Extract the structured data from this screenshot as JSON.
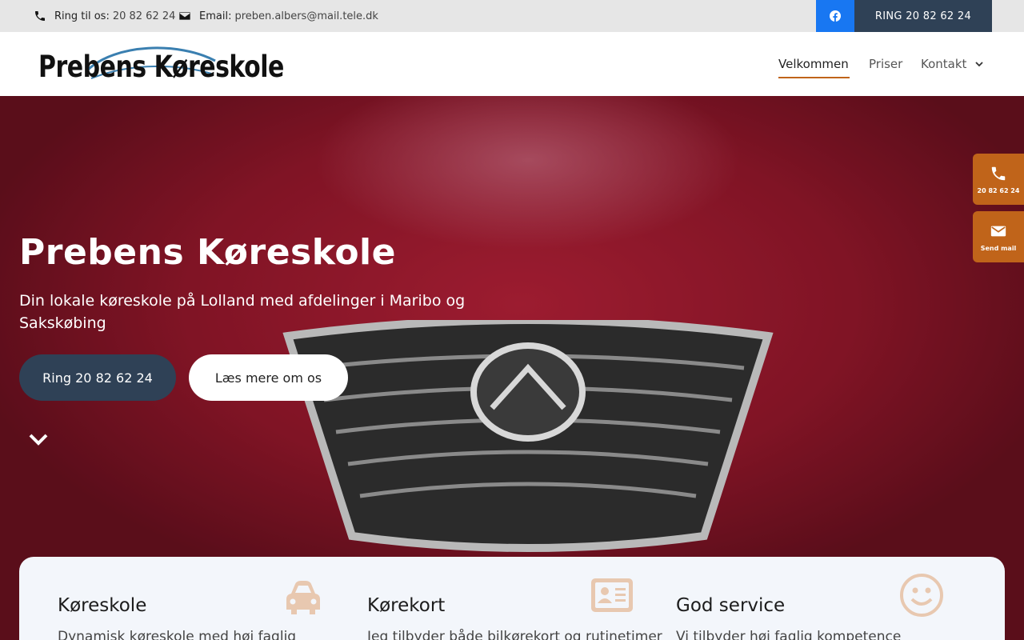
{
  "topbar": {
    "phone_label": "Ring til os:",
    "phone_value": "20 82 62 24",
    "email_label": "Email:",
    "email_value": "preben.albers@mail.tele.dk",
    "facebook_icon": "facebook-icon",
    "ring_button": "RING 20 82 62 24"
  },
  "header": {
    "logo_text": "Prebens Køreskole",
    "nav": [
      {
        "label": "Velkommen",
        "active": true
      },
      {
        "label": "Priser",
        "active": false
      },
      {
        "label": "Kontakt",
        "active": false
      }
    ]
  },
  "hero": {
    "title": "Prebens Køreskole",
    "subtitle": "Din lokale køreskole på Lolland med afdelinger i Maribo og Sakskøbing",
    "ring_button": "Ring 20 82 62 24",
    "more_button": "Læs mere om os"
  },
  "side": {
    "phone_label": "20 82 62 24",
    "mail_label": "Send mail"
  },
  "cards": [
    {
      "title": "Køreskole",
      "text": "Dynamisk køreskole med høj faglig",
      "icon": "car-icon"
    },
    {
      "title": "Kørekort",
      "text": "Jeg tilbyder både bilkørekort og rutinetimer",
      "icon": "id-card-icon"
    },
    {
      "title": "God service",
      "text": "Vi tilbyder høj faglig kompetence",
      "icon": "smile-icon"
    }
  ],
  "colors": {
    "accent": "#c0641a",
    "navy": "#2f4156",
    "facebook": "#1877f2",
    "topbar_bg": "#e6e6e6",
    "cards_bg": "#f3f6fb"
  }
}
